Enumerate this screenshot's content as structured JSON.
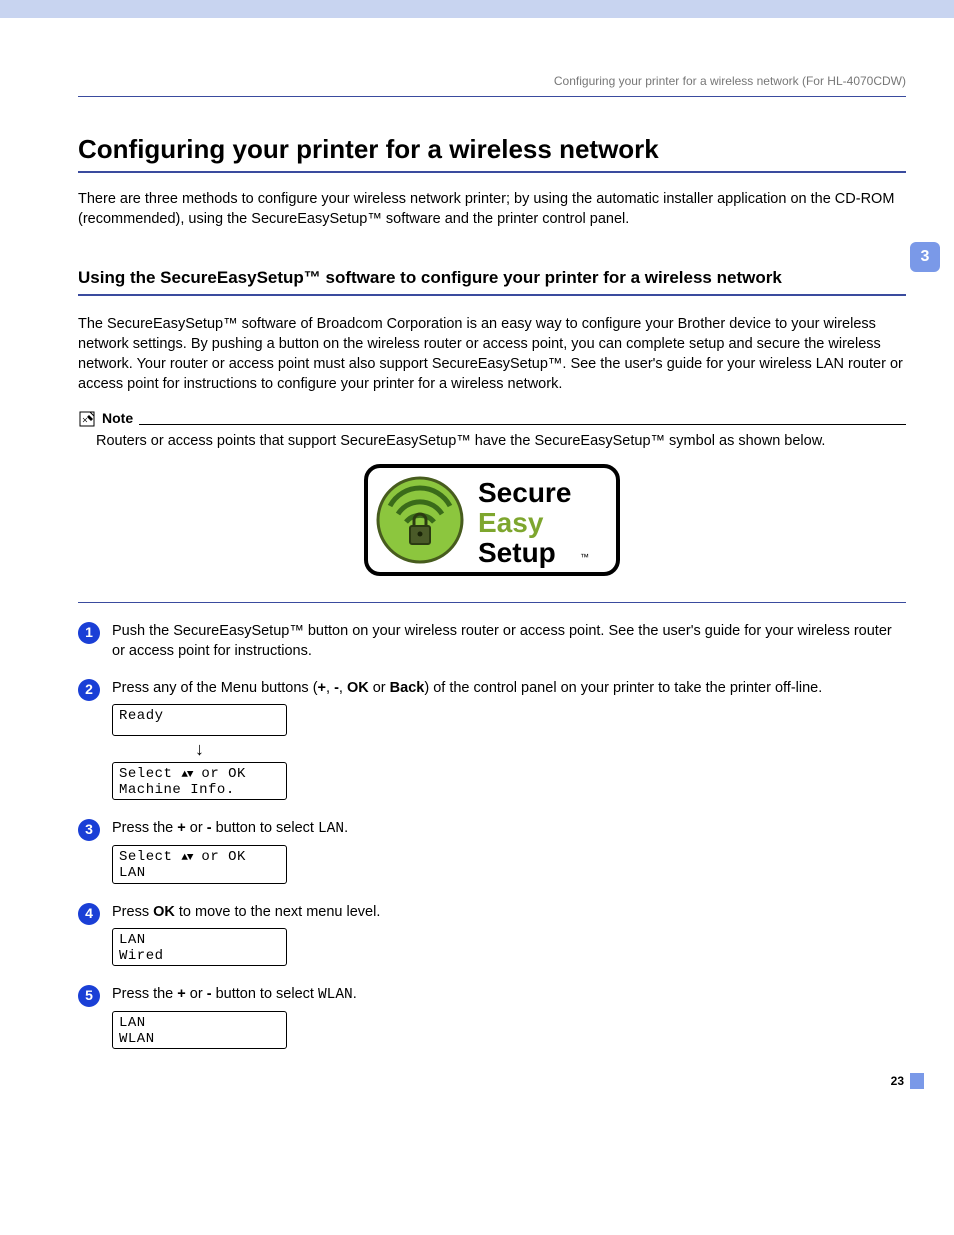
{
  "runningHead": "Configuring your printer for a wireless network (For HL-4070CDW)",
  "chapterTab": "3",
  "pageNumber": "23",
  "h1": "Configuring your printer for a wireless network",
  "intro": "There are three methods to configure your wireless network printer; by using the automatic installer application on the CD-ROM (recommended), using the SecureEasySetup™ software and the printer control panel.",
  "h2": "Using the SecureEasySetup™ software to configure your printer for a wireless network",
  "sectionPara": "The SecureEasySetup™ software of Broadcom Corporation is an easy way to configure your Brother device to your wireless network settings. By pushing a button on the wireless router or access point, you can complete setup and secure the wireless network. Your router or access point must also support SecureEasySetup™. See the user's guide for your wireless LAN router or access point for instructions to configure your printer for a wireless network.",
  "note": {
    "label": "Note",
    "body": "Routers or access points that support SecureEasySetup™ have the SecureEasySetup™ symbol as shown below."
  },
  "logo": {
    "line1": "Secure",
    "line2": "Easy",
    "line3": "Setup",
    "tm": "™"
  },
  "steps": {
    "s1": {
      "num": "1",
      "text": "Push the SecureEasySetup™ button on your wireless router or access point. See the user's guide for your wireless router or access point for instructions."
    },
    "s2": {
      "num": "2",
      "t_a": "Press any of the Menu buttons (",
      "t_plus": "+",
      "t_c1": ", ",
      "t_minus": "-",
      "t_c2": ", ",
      "t_ok": "OK",
      "t_or": " or ",
      "t_back": "Back",
      "t_b": ") of the control panel on your printer to take the printer off-line.",
      "lcd1": "Ready",
      "lcd2a": "Select ",
      "lcd2b": " or OK",
      "lcd2c": "Machine Info."
    },
    "s3": {
      "num": "3",
      "t_a": "Press the ",
      "t_plus": "+",
      "t_or": " or ",
      "t_minus": "-",
      "t_b": " button to select ",
      "t_lan": "LAN",
      "t_c": ".",
      "lcd_a": "Select ",
      "lcd_b": " or OK",
      "lcd_c": "LAN"
    },
    "s4": {
      "num": "4",
      "t_a": "Press ",
      "t_ok": "OK",
      "t_b": " to move to the next menu level.",
      "lcd_a": "LAN",
      "lcd_b": "Wired"
    },
    "s5": {
      "num": "5",
      "t_a": "Press the ",
      "t_plus": "+",
      "t_or": " or ",
      "t_minus": "-",
      "t_b": " button to select ",
      "t_wlan": "WLAN",
      "t_c": ".",
      "lcd_a": "LAN",
      "lcd_b": "WLAN"
    }
  }
}
